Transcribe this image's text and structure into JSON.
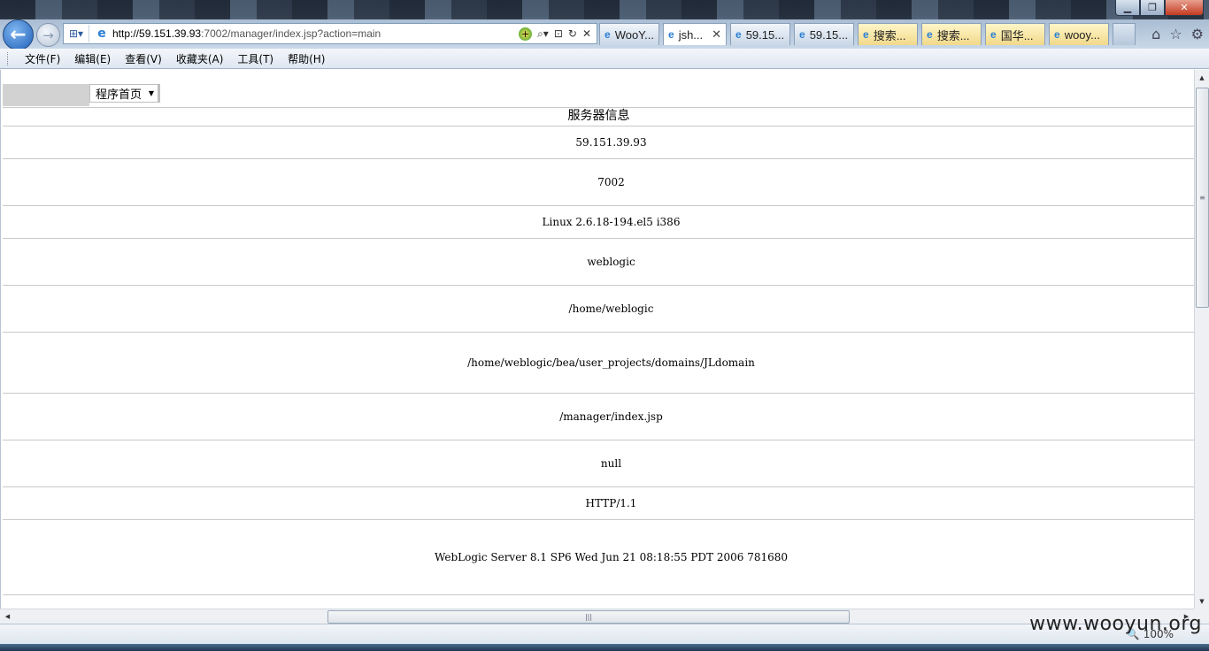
{
  "window": {
    "minimize_glyph": "▁",
    "maximize_glyph": "❐",
    "close_glyph": "✕"
  },
  "nav": {
    "back_glyph": "←",
    "forward_glyph": "→"
  },
  "address": {
    "compat_glyph": "⊞▾",
    "url_host": "http://59.151.39.93",
    "url_rest": ":7002/manager/index.jsp?action=main",
    "icons": [
      "search-icon",
      "refresh-icon",
      "stop-icon"
    ],
    "search_glyph": "⌕▾",
    "compat_view_glyph": "⊡",
    "refresh_glyph": "↻",
    "stop_glyph": "✕",
    "addon_glyph": "+"
  },
  "tabs": [
    {
      "label": "WooY...",
      "style": "normal"
    },
    {
      "label": "jsh...",
      "style": "active",
      "close": "✕"
    },
    {
      "label": "59.15...",
      "style": "normal"
    },
    {
      "label": "59.15...",
      "style": "normal"
    },
    {
      "label": "搜索...",
      "style": "yellow"
    },
    {
      "label": "搜索...",
      "style": "yellow"
    },
    {
      "label": "国华...",
      "style": "yellow"
    },
    {
      "label": "wooy...",
      "style": "yellow"
    }
  ],
  "toolbar_right": {
    "home_glyph": "⌂",
    "favorites_glyph": "☆",
    "settings_glyph": "⚙"
  },
  "menubar": {
    "items": [
      "文件(F)",
      "编辑(E)",
      "查看(V)",
      "收藏夹(A)",
      "工具(T)",
      "帮助(H)"
    ]
  },
  "page": {
    "nav_select_value": "程序首页",
    "info_title": "服务器信息",
    "rows": [
      "59.151.39.93",
      "7002",
      "Linux 2.6.18-194.el5 i386",
      "weblogic",
      "/home/weblogic",
      "/home/weblogic/bea/user_projects/domains/JLdomain",
      "/manager/index.jsp",
      "null",
      "HTTP/1.1",
      "WebLogic Server 8.1 SP6 Wed Jun 21 08:18:55 PDT 2006 781680"
    ]
  },
  "status": {
    "zoom": "100%",
    "watermark": "www.wooyun.org"
  },
  "colors": {
    "row_border": "#c8c8c8",
    "nav_gray": "#d2d2d2",
    "menubar_bg": "#dde6f1"
  }
}
